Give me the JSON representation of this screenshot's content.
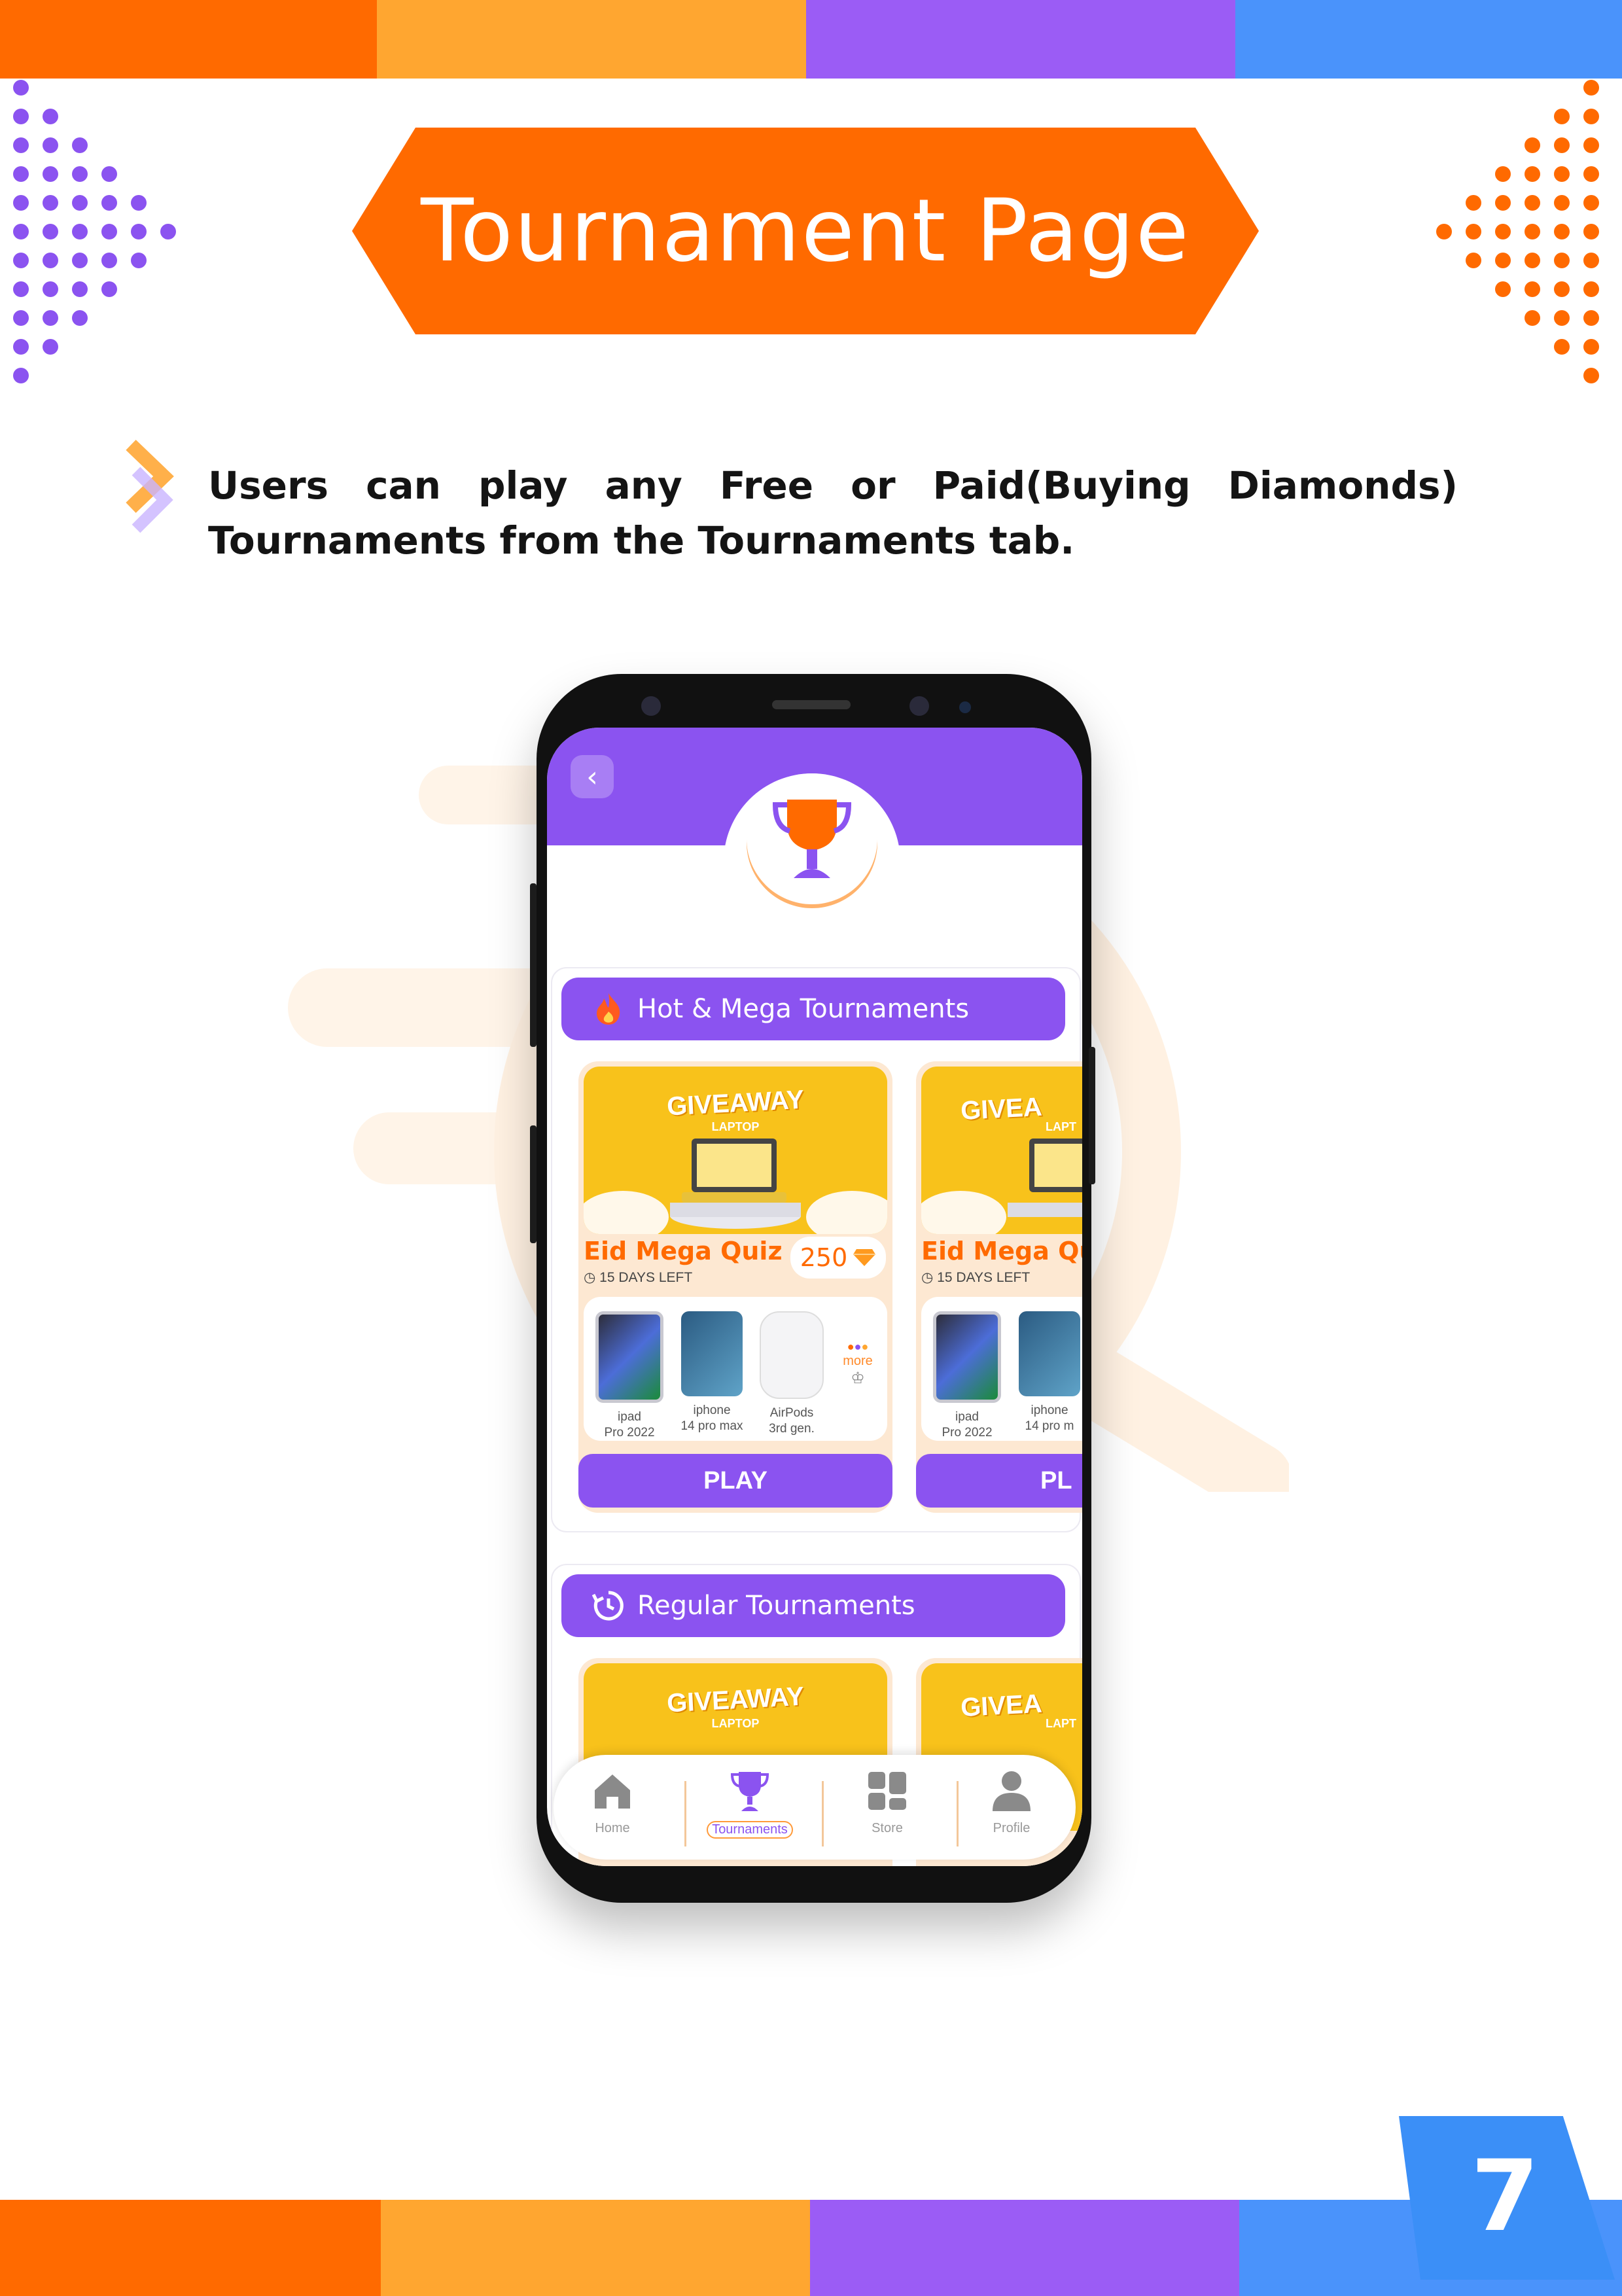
{
  "page": {
    "title": "Tournament Page",
    "intro_text": "Users can play any Free or Paid(Buying Diamonds) Tournaments from the Tournaments tab.",
    "page_number": "7"
  },
  "colors": {
    "orange": "#ff6a00",
    "light_orange": "#ffa630",
    "purple": "#8b53f0",
    "blue": "#4a90f7"
  },
  "app": {
    "header_icon": "trophy-icon",
    "back_icon": "chevron-left-icon",
    "hot_section": {
      "title": "Hot & Mega Tournaments",
      "icon": "flame-icon",
      "cards": [
        {
          "banner_title": "GIVEAWAY",
          "banner_sub": "LAPTOP",
          "name": "Eid Mega Quiz",
          "days_left": "15 DAYS LEFT",
          "price": "250",
          "prizes": [
            {
              "line1": "ipad",
              "line2": "Pro 2022"
            },
            {
              "line1": "iphone",
              "line2": "14 pro max"
            },
            {
              "line1": "AirPods",
              "line2": "3rd gen."
            }
          ],
          "more_label": "more",
          "play_label": "PLAY"
        },
        {
          "banner_title": "GIVEA",
          "banner_sub": "LAPT",
          "name": "Eid Mega Qui:",
          "days_left": "15 DAYS LEFT",
          "prizes": [
            {
              "line1": "ipad",
              "line2": "Pro 2022"
            },
            {
              "line1": "iphone",
              "line2": "14 pro m"
            }
          ],
          "play_label": "PL"
        }
      ]
    },
    "regular_section": {
      "title": "Regular Tournaments",
      "icon": "refresh-clock-icon",
      "cards": [
        {
          "banner_title": "GIVEAWAY",
          "banner_sub": "LAPTOP"
        },
        {
          "banner_title": "GIVEA",
          "banner_sub": "LAPT"
        }
      ]
    },
    "nav": [
      {
        "label": "Home",
        "icon": "home-icon"
      },
      {
        "label": "Tournaments",
        "icon": "trophy-icon",
        "active": true
      },
      {
        "label": "Store",
        "icon": "grid-icon"
      },
      {
        "label": "Profile",
        "icon": "user-icon"
      }
    ]
  }
}
